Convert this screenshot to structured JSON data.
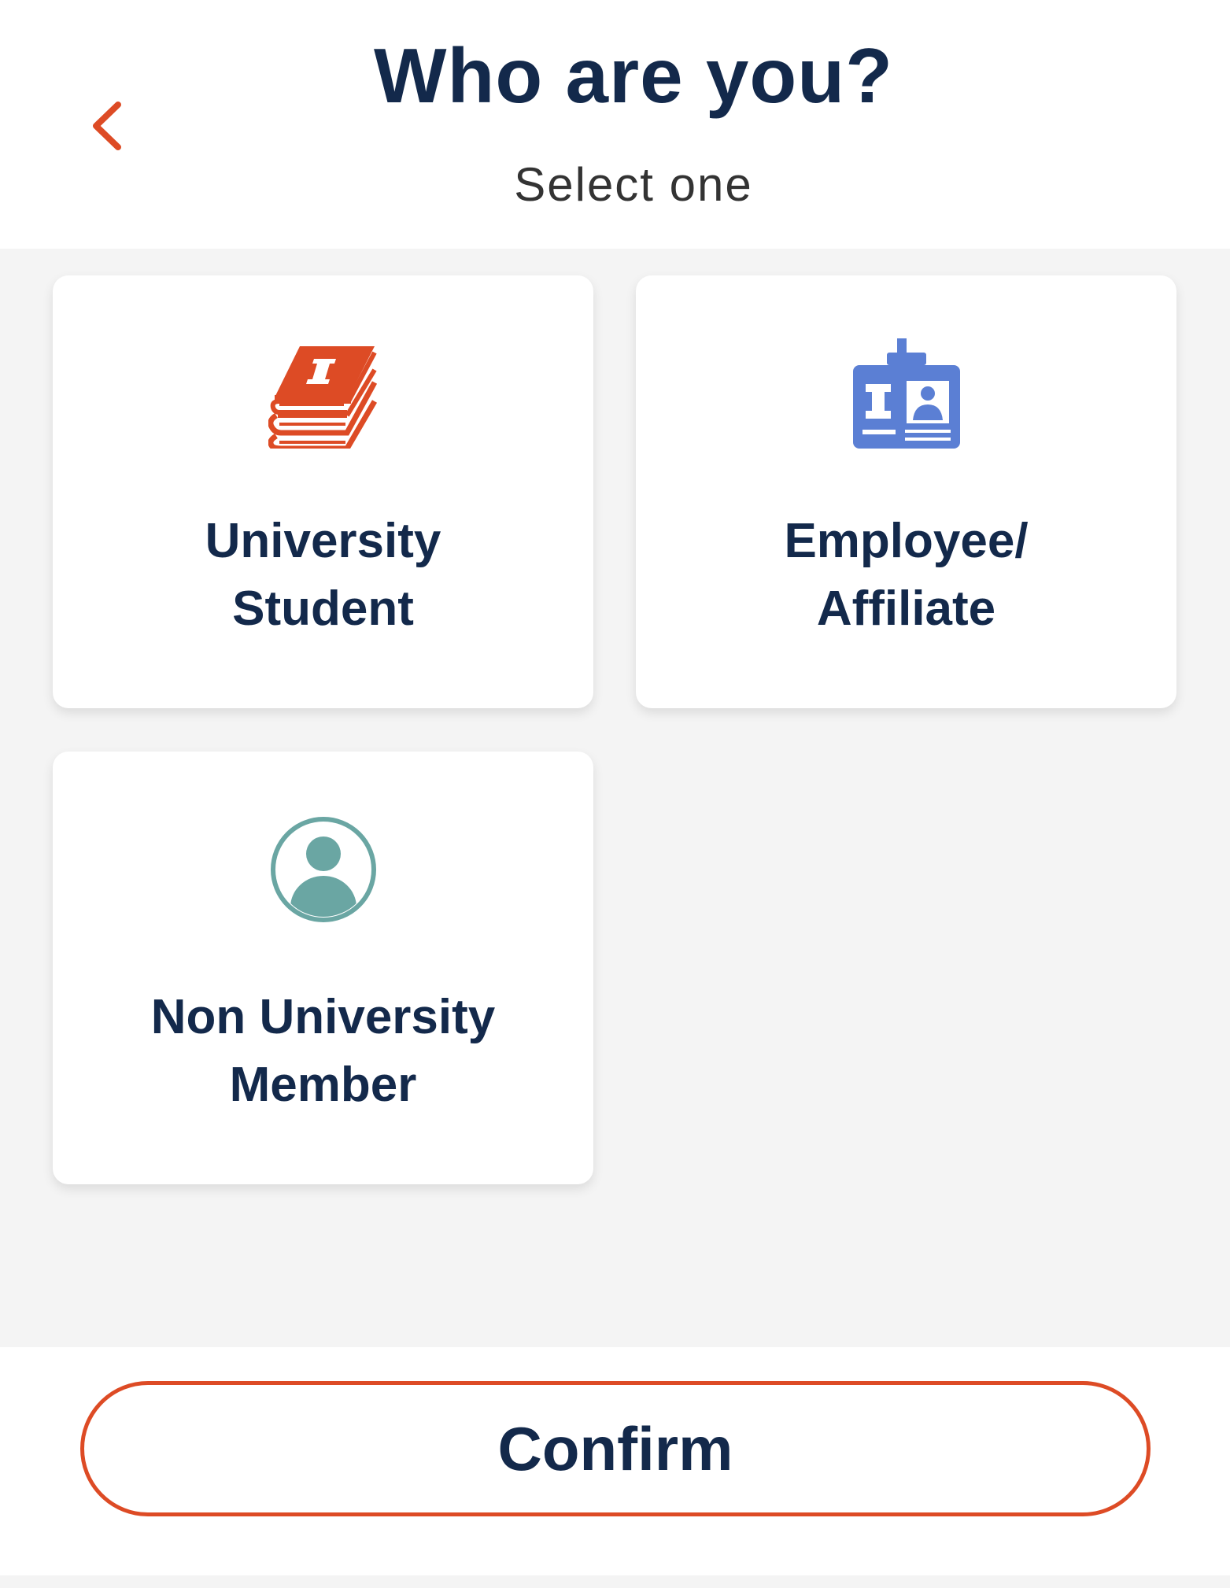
{
  "header": {
    "title": "Who are you?",
    "subtitle": "Select one",
    "back_icon": "chevron-left-icon"
  },
  "options": [
    {
      "line1": "University",
      "line2": "Student",
      "icon": "books-icon",
      "icon_color": "#dd4b25"
    },
    {
      "line1": "Employee/",
      "line2": "Affiliate",
      "icon": "id-badge-icon",
      "icon_color": "#5b7fd4"
    },
    {
      "line1": "Non University",
      "line2": "Member",
      "icon": "user-circle-icon",
      "icon_color": "#6aa6a3"
    }
  ],
  "footer": {
    "confirm_label": "Confirm"
  },
  "colors": {
    "accent": "#dd4b25",
    "title": "#13294b",
    "background": "#f4f4f4"
  }
}
